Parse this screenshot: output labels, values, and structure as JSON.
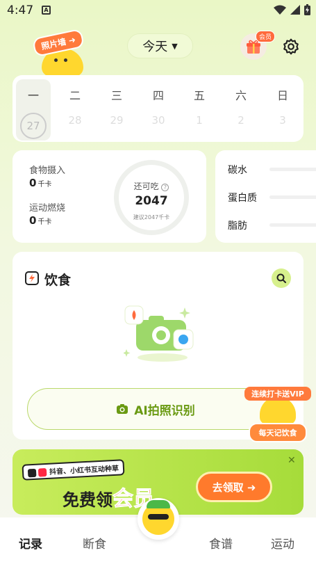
{
  "status_bar": {
    "time": "4:47",
    "indicator": "A"
  },
  "header": {
    "photo_wall_label": "照片墙 ➜",
    "date_label": "今天",
    "vip_badge": "会员"
  },
  "week": [
    {
      "weekday": "一",
      "date": "27",
      "active": true
    },
    {
      "weekday": "二",
      "date": "28",
      "active": false
    },
    {
      "weekday": "三",
      "date": "29",
      "active": false
    },
    {
      "weekday": "四",
      "date": "30",
      "active": false
    },
    {
      "weekday": "五",
      "date": "1",
      "active": false
    },
    {
      "weekday": "六",
      "date": "2",
      "active": false
    },
    {
      "weekday": "日",
      "date": "3",
      "active": false
    }
  ],
  "intake": {
    "food_label": "食物摄入",
    "food_value": "0",
    "food_unit": "千卡",
    "burn_label": "运动燃烧",
    "burn_value": "0",
    "burn_unit": "千卡",
    "remaining_label": "还可吃",
    "remaining_value": "2047",
    "suggest_label": "建议2047千卡"
  },
  "macros": [
    {
      "label": "碳水",
      "progress": 0
    },
    {
      "label": "蛋白质",
      "progress": 0
    },
    {
      "label": "脂肪",
      "progress": 0
    }
  ],
  "diet": {
    "title": "饮食",
    "ai_button_label": "AI拍照识别"
  },
  "checkin_promo": {
    "top_label": "连续打卡送VIP",
    "bottom_label": "每天记饮食"
  },
  "banner": {
    "tag_label": "抖音、小红书互动种草",
    "main_label": "免费领",
    "vip_label": "会员",
    "cta_label": "去领取 ➜",
    "close_label": "✕"
  },
  "bottom_nav": {
    "items": [
      "记录",
      "断食",
      "食谱",
      "运动"
    ]
  },
  "colors": {
    "accent": "#d5f06a",
    "brand_green": "#6a9a12",
    "orange": "#ff7a3c"
  }
}
